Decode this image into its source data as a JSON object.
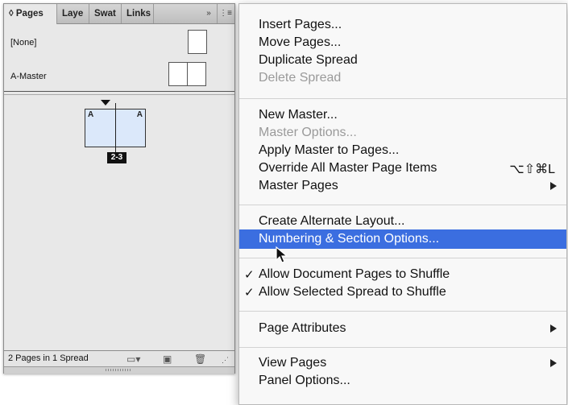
{
  "panel": {
    "tabs": {
      "pages": "◊ Pages",
      "layers": "Laye",
      "swatches": "Swat",
      "links": "Links",
      "fast_forward_icon": "»",
      "menu_icon": "⋮≡"
    },
    "masters": [
      {
        "label": "[None]"
      },
      {
        "label": "A-Master"
      }
    ],
    "spread": {
      "left_master": "A",
      "right_master": "A",
      "page_range": "2-3"
    },
    "status": "2 Pages in 1 Spread"
  },
  "menu": {
    "insert_pages": "Insert Pages...",
    "move_pages": "Move Pages...",
    "duplicate_spread": "Duplicate Spread",
    "delete_spread": "Delete Spread",
    "new_master": "New Master...",
    "master_options": "Master Options...",
    "apply_master": "Apply Master to Pages...",
    "override_all": "Override All Master Page Items",
    "override_shortcut": "⌥⇧⌘L",
    "master_pages": "Master Pages",
    "create_alternate_layout": "Create Alternate Layout...",
    "numbering_section": "Numbering & Section Options...",
    "allow_doc_shuffle": "Allow Document Pages to Shuffle",
    "allow_spread_shuffle": "Allow Selected Spread to Shuffle",
    "check_mark": "✓",
    "page_attributes": "Page Attributes",
    "view_pages": "View Pages",
    "panel_options": "Panel Options..."
  },
  "colors": {
    "highlight": "#3b6ee0",
    "spread_fill": "#dbe8fa"
  }
}
